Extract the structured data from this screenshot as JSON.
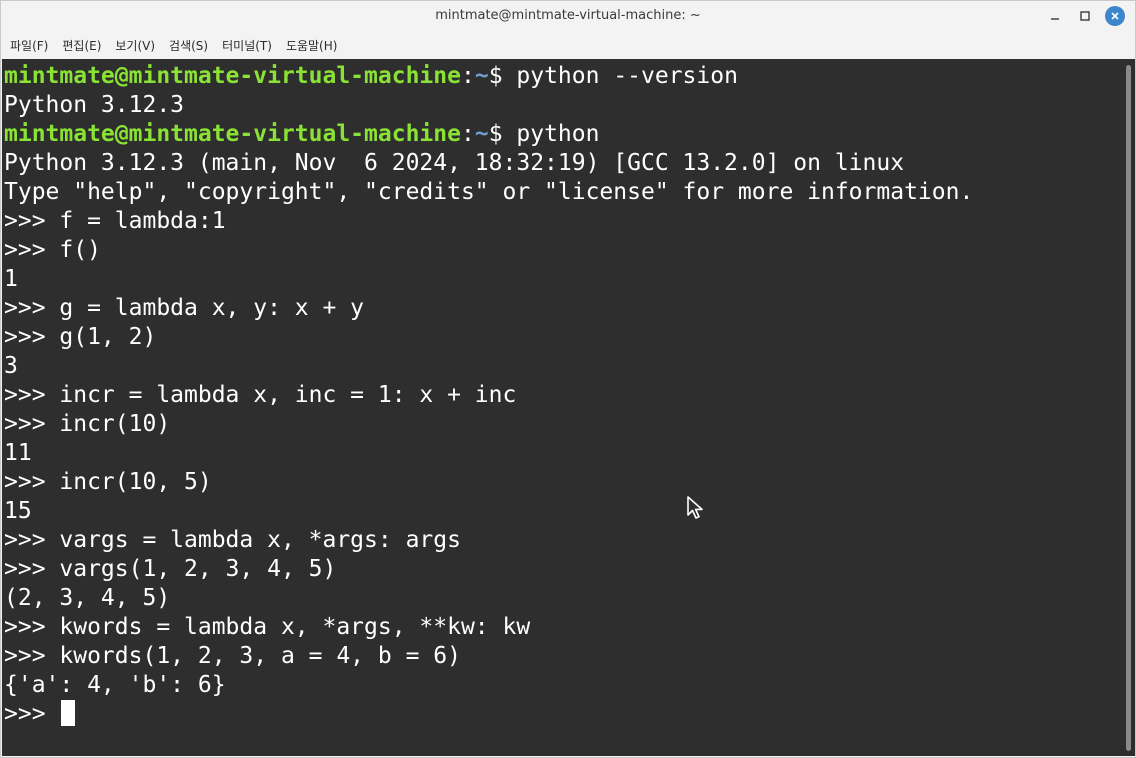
{
  "window": {
    "title": "mintmate@mintmate-virtual-machine: ~",
    "controls": {
      "minimize_icon": "minimize-icon",
      "maximize_icon": "maximize-icon",
      "close_icon": "close-icon"
    }
  },
  "menubar": {
    "items": [
      "파일(F)",
      "편집(E)",
      "보기(V)",
      "검색(S)",
      "터미널(T)",
      "도움말(H)"
    ]
  },
  "colors": {
    "terminal_bg": "#2e2e2e",
    "prompt_user": "#8ae234",
    "prompt_path": "#729fcf",
    "text": "#ffffff",
    "close_button": "#3d86c9"
  },
  "terminal": {
    "prompt": {
      "user_host": "mintmate@mintmate-virtual-machine",
      "separator": ":",
      "path": "~",
      "symbol": "$ "
    },
    "lines": [
      {
        "type": "prompt",
        "command": "python --version"
      },
      {
        "type": "output",
        "text": "Python 3.12.3"
      },
      {
        "type": "prompt",
        "command": "python"
      },
      {
        "type": "output",
        "text": "Python 3.12.3 (main, Nov  6 2024, 18:32:19) [GCC 13.2.0] on linux"
      },
      {
        "type": "output",
        "text": "Type \"help\", \"copyright\", \"credits\" or \"license\" for more information."
      },
      {
        "type": "output",
        "text": ">>> f = lambda:1"
      },
      {
        "type": "output",
        "text": ">>> f()"
      },
      {
        "type": "output",
        "text": "1"
      },
      {
        "type": "output",
        "text": ">>> g = lambda x, y: x + y"
      },
      {
        "type": "output",
        "text": ">>> g(1, 2)"
      },
      {
        "type": "output",
        "text": "3"
      },
      {
        "type": "output",
        "text": ">>> incr = lambda x, inc = 1: x + inc"
      },
      {
        "type": "output",
        "text": ">>> incr(10)"
      },
      {
        "type": "output",
        "text": "11"
      },
      {
        "type": "output",
        "text": ">>> incr(10, 5)"
      },
      {
        "type": "output",
        "text": "15"
      },
      {
        "type": "output",
        "text": ">>> vargs = lambda x, *args: args"
      },
      {
        "type": "output",
        "text": ">>> vargs(1, 2, 3, 4, 5)"
      },
      {
        "type": "output",
        "text": "(2, 3, 4, 5)"
      },
      {
        "type": "output",
        "text": ">>> kwords = lambda x, *args, **kw: kw"
      },
      {
        "type": "output",
        "text": ">>> kwords(1, 2, 3, a = 4, b = 6)"
      },
      {
        "type": "output",
        "text": "{'a': 4, 'b': 6}"
      },
      {
        "type": "input",
        "text": ">>> "
      }
    ]
  }
}
